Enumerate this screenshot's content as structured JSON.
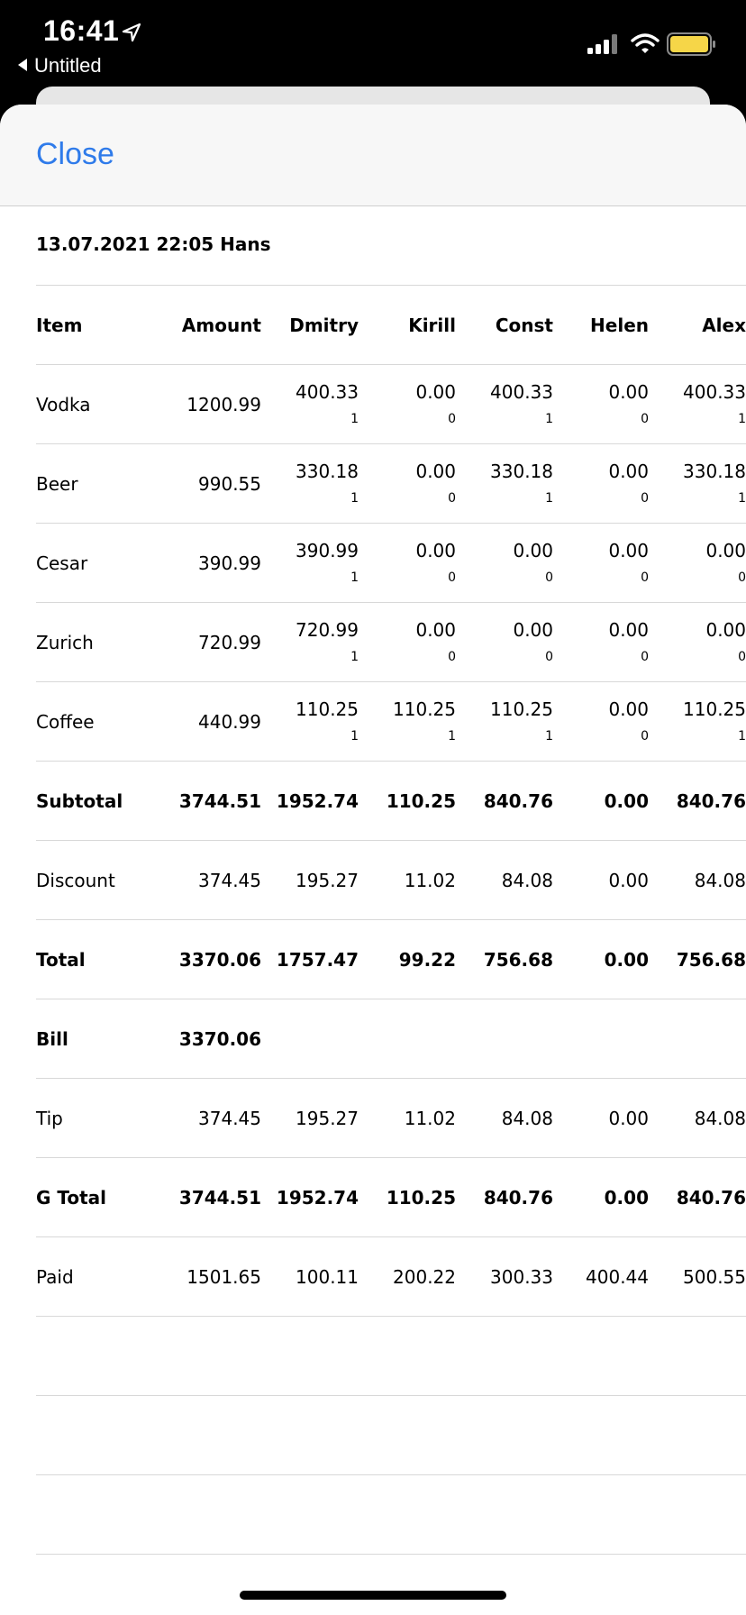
{
  "status_bar": {
    "time": "16:41",
    "back_app": "Untitled"
  },
  "header": {
    "close_label": "Close"
  },
  "title": "13.07.2021 22:05 Hans",
  "columns": [
    "Item",
    "Amount",
    "Dmitry",
    "Kirill",
    "Const",
    "Helen",
    "Alex"
  ],
  "items": [
    {
      "name": "Vodka",
      "amount": "1200.99",
      "shares": [
        {
          "v": "400.33",
          "c": "1"
        },
        {
          "v": "0.00",
          "c": "0"
        },
        {
          "v": "400.33",
          "c": "1"
        },
        {
          "v": "0.00",
          "c": "0"
        },
        {
          "v": "400.33",
          "c": "1"
        }
      ]
    },
    {
      "name": "Beer",
      "amount": "990.55",
      "shares": [
        {
          "v": "330.18",
          "c": "1"
        },
        {
          "v": "0.00",
          "c": "0"
        },
        {
          "v": "330.18",
          "c": "1"
        },
        {
          "v": "0.00",
          "c": "0"
        },
        {
          "v": "330.18",
          "c": "1"
        }
      ]
    },
    {
      "name": "Cesar",
      "amount": "390.99",
      "shares": [
        {
          "v": "390.99",
          "c": "1"
        },
        {
          "v": "0.00",
          "c": "0"
        },
        {
          "v": "0.00",
          "c": "0"
        },
        {
          "v": "0.00",
          "c": "0"
        },
        {
          "v": "0.00",
          "c": "0"
        }
      ]
    },
    {
      "name": "Zurich",
      "amount": "720.99",
      "shares": [
        {
          "v": "720.99",
          "c": "1"
        },
        {
          "v": "0.00",
          "c": "0"
        },
        {
          "v": "0.00",
          "c": "0"
        },
        {
          "v": "0.00",
          "c": "0"
        },
        {
          "v": "0.00",
          "c": "0"
        }
      ]
    },
    {
      "name": "Coffee",
      "amount": "440.99",
      "shares": [
        {
          "v": "110.25",
          "c": "1"
        },
        {
          "v": "110.25",
          "c": "1"
        },
        {
          "v": "110.25",
          "c": "1"
        },
        {
          "v": "0.00",
          "c": "0"
        },
        {
          "v": "110.25",
          "c": "1"
        }
      ]
    }
  ],
  "summary": [
    {
      "label": "Subtotal",
      "bold": true,
      "amount": "3744.51",
      "values": [
        "1952.74",
        "110.25",
        "840.76",
        "0.00",
        "840.76"
      ]
    },
    {
      "label": "Discount",
      "bold": false,
      "amount": "374.45",
      "values": [
        "195.27",
        "11.02",
        "84.08",
        "0.00",
        "84.08"
      ]
    },
    {
      "label": "Total",
      "bold": true,
      "amount": "3370.06",
      "values": [
        "1757.47",
        "99.22",
        "756.68",
        "0.00",
        "756.68"
      ]
    },
    {
      "label": "Bill",
      "bold": true,
      "amount": "3370.06",
      "values": [
        "",
        "",
        "",
        "",
        ""
      ]
    },
    {
      "label": "Tip",
      "bold": false,
      "amount": "374.45",
      "values": [
        "195.27",
        "11.02",
        "84.08",
        "0.00",
        "84.08"
      ]
    },
    {
      "label": "G Total",
      "bold": true,
      "amount": "3744.51",
      "values": [
        "1952.74",
        "110.25",
        "840.76",
        "0.00",
        "840.76"
      ]
    },
    {
      "label": "Paid",
      "bold": false,
      "amount": "1501.65",
      "values": [
        "100.11",
        "200.22",
        "300.33",
        "400.44",
        "500.55"
      ]
    }
  ],
  "colors": {
    "accent": "#2f7bea",
    "battery": "#f6d648"
  }
}
